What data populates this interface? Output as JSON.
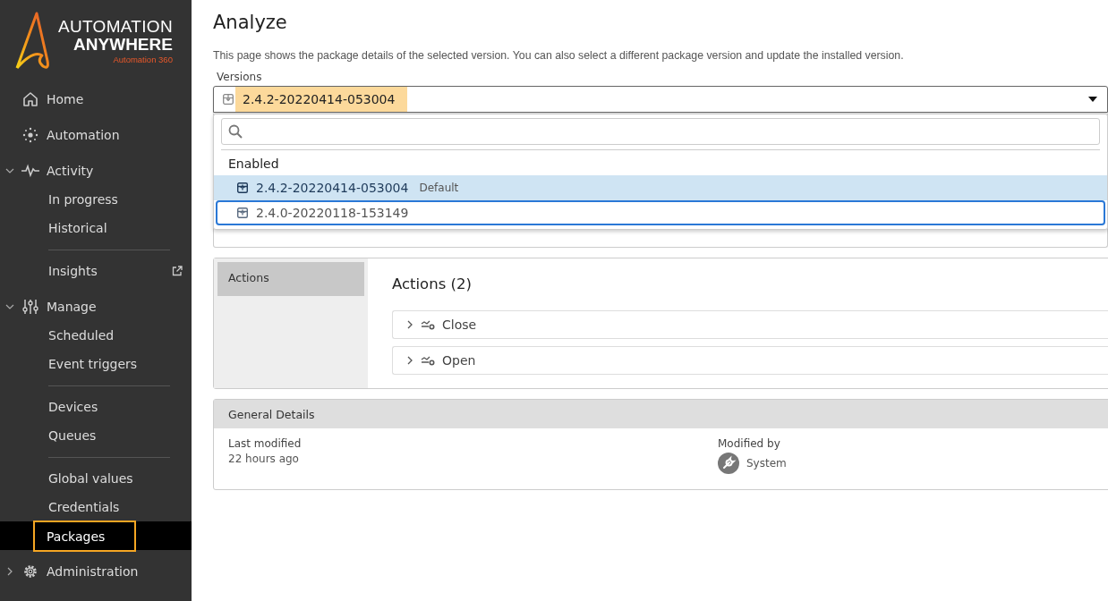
{
  "sidebar": {
    "logo": {
      "line1": "AUTOMATION",
      "line2": "ANYWHERE",
      "tagline": "Automation 360"
    },
    "items": [
      {
        "label": "Home",
        "selected": false
      },
      {
        "label": "Automation",
        "selected": false
      },
      {
        "label": "Activity",
        "selected": false,
        "expanded": true,
        "children": [
          {
            "label": "In progress",
            "selected": false
          },
          {
            "label": "Historical",
            "selected": false
          },
          {
            "label": "Insights",
            "selected": false,
            "divider_before": true,
            "external": true
          }
        ]
      },
      {
        "label": "Manage",
        "selected": false,
        "expanded": true,
        "children": [
          {
            "label": "Scheduled",
            "selected": false
          },
          {
            "label": "Event triggers",
            "selected": false
          },
          {
            "label": "Devices",
            "selected": false,
            "divider_before": true
          },
          {
            "label": "Queues",
            "selected": false
          },
          {
            "label": "Global values",
            "selected": false,
            "divider_before": true
          },
          {
            "label": "Credentials",
            "selected": false
          },
          {
            "label": "Packages",
            "selected": true
          }
        ]
      },
      {
        "label": "Administration",
        "selected": false,
        "expanded": false
      }
    ]
  },
  "page": {
    "title": "Analyze",
    "description": "This page shows the package details of the selected version. You can also select a different package version and update the installed version."
  },
  "versions": {
    "label": "Versions",
    "value": "2.4.2-20220414-053004",
    "highlighted": true,
    "open": true,
    "dropdown": {
      "group": "Enabled",
      "options": [
        {
          "version": "2.4.2-20220414-053004",
          "tag": "Default",
          "selected": true,
          "focused": false
        },
        {
          "version": "2.4.0-20220118-153149",
          "selected": false,
          "focused": true
        }
      ]
    }
  },
  "actions_panel": {
    "tabs": [
      {
        "label": "Actions",
        "selected": true
      }
    ],
    "heading": "Actions (2)",
    "actions": [
      {
        "label": "Close",
        "expanded": false
      },
      {
        "label": "Open",
        "expanded": false
      }
    ]
  },
  "general_details": {
    "title": "General Details",
    "fields": [
      {
        "kind": "text",
        "label": "Last modified",
        "value": "22 hours ago"
      },
      {
        "kind": "user",
        "label": "Modified by",
        "value": "System"
      }
    ]
  }
}
